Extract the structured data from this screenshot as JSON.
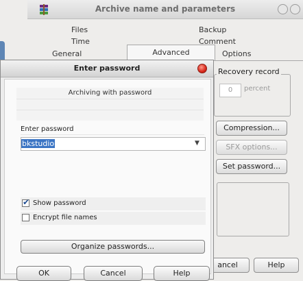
{
  "archive_dialog": {
    "title": "Archive name and parameters",
    "tabs_row1": [
      "Files",
      "Backup",
      "Time",
      "Comment"
    ],
    "tabs_row2": [
      "General",
      "Advanced",
      "Options"
    ],
    "recovery_record": {
      "label": "Recovery record",
      "value": "0",
      "unit": "percent"
    },
    "buttons": {
      "compression": "Compression...",
      "sfx_options": "SFX options...",
      "set_password": "Set password...",
      "cancel": "ancel",
      "help": "Help"
    }
  },
  "password_dialog": {
    "title": "Enter password",
    "info": "Archiving with password",
    "enter_label": "Enter password",
    "password_value": "bkstudio",
    "show_password": {
      "label": "Show password",
      "checked": true
    },
    "encrypt_names": {
      "label": "Encrypt file names",
      "checked": false
    },
    "organize_label": "Organize passwords...",
    "ok_label": "OK",
    "cancel_label": "Cancel",
    "help_label": "Help"
  }
}
